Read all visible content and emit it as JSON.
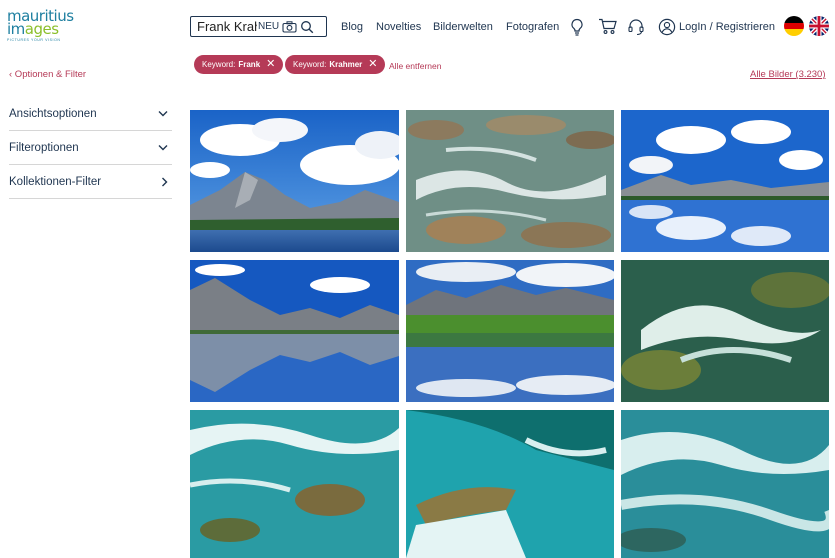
{
  "logo": {
    "line1": "mauritius",
    "line2a": "im",
    "line2b": "ages",
    "tagline": "PICTURES YOUR VISION"
  },
  "search": {
    "value": "Frank Krah",
    "badge": "NEU"
  },
  "nav": {
    "blog": "Blog",
    "novelties": "Novelties",
    "bilderwelten": "Bilderwelten",
    "fotografen": "Fotografen",
    "login": "LogIn / Registrieren"
  },
  "filters": {
    "back_label": "‹ Optionen & Filter",
    "chips": [
      {
        "prefix": "Keyword:",
        "value": "Frank"
      },
      {
        "prefix": "Keyword:",
        "value": "Krahmer"
      }
    ],
    "remove_all": "Alle entfernen",
    "all_images": "Alle Bilder (3.230)"
  },
  "sidebar": {
    "items": [
      {
        "label": "Ansichtsoptionen"
      },
      {
        "label": "Filteroptionen"
      },
      {
        "label": "Kollektionen-Filter"
      }
    ]
  },
  "colors": {
    "accent": "#b53a57",
    "nav": "#1f3550"
  }
}
